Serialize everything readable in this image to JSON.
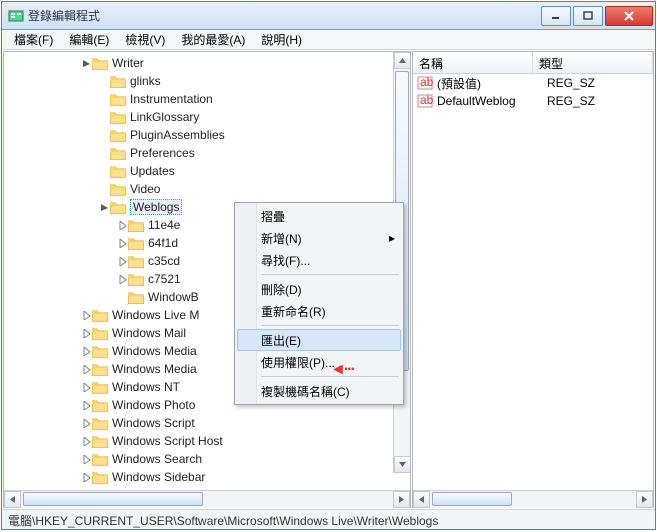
{
  "window": {
    "title": "登錄編輯程式"
  },
  "menu": {
    "file": "檔案(F)",
    "edit": "編輯(E)",
    "view": "檢視(V)",
    "favorites": "我的最愛(A)",
    "help": "說明(H)"
  },
  "tree": {
    "writer": "Writer",
    "children": [
      {
        "label": "glinks"
      },
      {
        "label": "Instrumentation"
      },
      {
        "label": "LinkGlossary"
      },
      {
        "label": "PluginAssemblies"
      },
      {
        "label": "Preferences"
      },
      {
        "label": "Updates"
      },
      {
        "label": "Video"
      },
      {
        "label": "Weblogs",
        "selected": true,
        "expanded": true,
        "children": [
          {
            "label": "11e4e",
            "expandable": true
          },
          {
            "label": "64f1d",
            "expandable": true
          },
          {
            "label": "c35cd",
            "expandable": true
          },
          {
            "label": "c7521",
            "expandable": true
          },
          {
            "label": "WindowB"
          }
        ]
      }
    ],
    "siblings_after": [
      "Windows Live M",
      "Windows Mail",
      "Windows Media",
      "Windows Media",
      "Windows NT",
      "Windows Photo",
      "Windows Script",
      "Windows Script Host",
      "Windows Search",
      "Windows Sidebar"
    ]
  },
  "columns": {
    "name": "名稱",
    "type": "類型"
  },
  "values": [
    {
      "name": "(預設值)",
      "type": "REG_SZ"
    },
    {
      "name": "DefaultWeblog",
      "type": "REG_SZ"
    }
  ],
  "context_menu": {
    "collapse": "摺疊",
    "new": "新增(N)",
    "find": "尋找(F)...",
    "delete": "刪除(D)",
    "rename": "重新命名(R)",
    "export": "匯出(E)",
    "permissions": "使用權限(P)...",
    "copy_key_name": "複製機碼名稱(C)"
  },
  "status": "電腦\\HKEY_CURRENT_USER\\Software\\Microsoft\\Windows Live\\Writer\\Weblogs",
  "chart_data": null
}
